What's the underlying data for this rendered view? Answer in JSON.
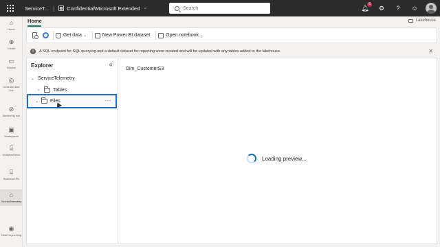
{
  "header": {
    "app_name": "ServiceT...",
    "workspace": "Confidential\\Microsoft Extended",
    "search_placeholder": "Search",
    "notification_count": "6"
  },
  "left_nav": {
    "items": [
      {
        "label": "Home",
        "icon": "home-icon"
      },
      {
        "label": "Create",
        "icon": "create-icon"
      },
      {
        "label": "Browse",
        "icon": "browse-icon"
      },
      {
        "label": "OneLake data hub",
        "icon": "onelake-icon"
      },
      {
        "label": "Monitoring hub",
        "icon": "monitoring-icon"
      },
      {
        "label": "Workspaces",
        "icon": "workspaces-icon"
      },
      {
        "label": "AnalyticsDemo",
        "icon": "workspace-item-icon"
      },
      {
        "label": "BusinessKPIs",
        "icon": "workspace-item-icon"
      },
      {
        "label": "ServiceTelemetry",
        "icon": "lakehouse-icon"
      },
      {
        "label": "Data Engineering",
        "icon": "data-engineering-icon"
      }
    ]
  },
  "ribbon": {
    "tab": "Home",
    "mode_switch": "Lakehouse",
    "get_data": "Get data",
    "new_dataset": "New Power BI dataset",
    "open_notebook": "Open notebook"
  },
  "info_bar": {
    "message": "A SQL endpoint for SQL querying and a default dataset for reporting were created and will be updated with any tables added to the lakehouse."
  },
  "explorer": {
    "title": "Explorer",
    "root": "ServiceTelemetry",
    "tables": "Tables",
    "files": "Files"
  },
  "preview": {
    "title": "Dim_CustomerS3",
    "loading": "Loading preview..."
  },
  "colors": {
    "header_bg": "#2b2b2b",
    "accent": "#117865",
    "selection_border": "#1f6fc5"
  }
}
